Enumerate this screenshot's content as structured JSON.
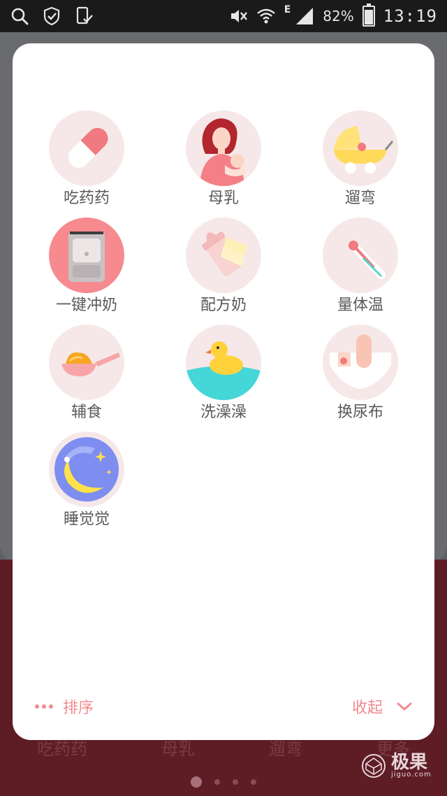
{
  "status_bar": {
    "battery": "82%",
    "battery_level": 0.82,
    "network": "E",
    "time": "13:19"
  },
  "grid": {
    "items": [
      {
        "label": "吃药药",
        "icon": "medicine-capsule-icon"
      },
      {
        "label": "母乳",
        "icon": "breastfeeding-mother-icon"
      },
      {
        "label": "遛弯",
        "icon": "baby-stroller-icon"
      },
      {
        "label": "一键冲奶",
        "icon": "formula-machine-icon"
      },
      {
        "label": "配方奶",
        "icon": "baby-bottle-icon"
      },
      {
        "label": "量体温",
        "icon": "thermometer-icon"
      },
      {
        "label": "辅食",
        "icon": "food-spoon-icon"
      },
      {
        "label": "洗澡澡",
        "icon": "bath-duck-icon"
      },
      {
        "label": "换尿布",
        "icon": "diaper-icon"
      },
      {
        "label": "睡觉觉",
        "icon": "sleep-moon-icon"
      }
    ]
  },
  "footer": {
    "sort_label": "排序",
    "collapse_label": "收起"
  },
  "background": {
    "tabs": [
      "吃药药",
      "母乳",
      "遛弯",
      "更多"
    ],
    "page_count": 4,
    "active_page": 1
  },
  "watermark": {
    "cn": "极果",
    "en": "jiguo.com"
  },
  "colors": {
    "accent": "#f28a8e",
    "icon_bg": "#f6e8e8",
    "bottom_bar": "#5e1d25"
  }
}
